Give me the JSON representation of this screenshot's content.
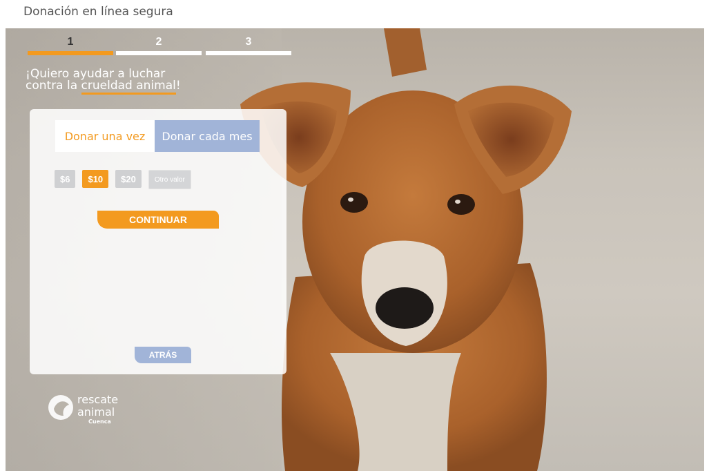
{
  "header": {
    "title": "Donación en línea segura"
  },
  "steps": [
    {
      "label": "1",
      "active": true
    },
    {
      "label": "2",
      "active": false
    },
    {
      "label": "3",
      "active": false
    }
  ],
  "headline": {
    "line1": "¡Quiero ayudar a luchar",
    "line2_prefix": "contra la ",
    "line2_highlight": "crueldad animal",
    "line2_suffix": "!"
  },
  "donation": {
    "tabs": {
      "once": "Donar una vez",
      "monthly": "Donar cada mes"
    },
    "amounts": [
      "$6",
      "$10",
      "$20",
      "Otro valor"
    ],
    "selected_amount": "$10",
    "continue_label": "CONTINUAR",
    "back_label": "ATRÁS"
  },
  "logo": {
    "line1": "rescate",
    "line2": "animal",
    "line3": "Cuenca"
  },
  "colors": {
    "accent": "#f39a1f",
    "secondary": "#a1b4d8"
  }
}
